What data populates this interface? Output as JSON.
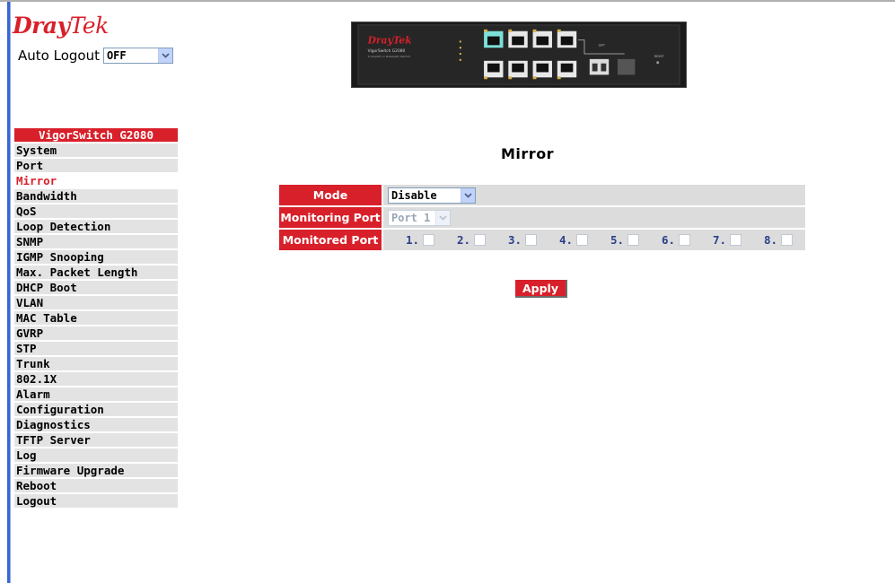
{
  "brand": {
    "logo_part1": "Dray",
    "logo_part2": "Tek"
  },
  "auto_logout": {
    "label": "Auto Logout",
    "value": "OFF"
  },
  "device": {
    "brand": "DrayTek",
    "model": "VigorSwitch G2080",
    "subtitle": "8 GIGABIT L2 MANAGED SWITCH",
    "sfp_label": "SFP",
    "reset_label": "RESET"
  },
  "sidebar": {
    "header": "VigorSwitch G2080",
    "items": [
      {
        "label": "System"
      },
      {
        "label": "Port"
      },
      {
        "label": "Mirror",
        "active": true
      },
      {
        "label": "Bandwidth"
      },
      {
        "label": "QoS"
      },
      {
        "label": "Loop Detection"
      },
      {
        "label": "SNMP"
      },
      {
        "label": "IGMP Snooping"
      },
      {
        "label": "Max. Packet Length"
      },
      {
        "label": "DHCP Boot"
      },
      {
        "label": "VLAN"
      },
      {
        "label": "MAC Table"
      },
      {
        "label": "GVRP"
      },
      {
        "label": "STP"
      },
      {
        "label": "Trunk"
      },
      {
        "label": "802.1X"
      },
      {
        "label": "Alarm"
      },
      {
        "label": "Configuration"
      },
      {
        "label": "Diagnostics"
      },
      {
        "label": "TFTP Server"
      },
      {
        "label": "Log"
      },
      {
        "label": "Firmware Upgrade"
      },
      {
        "label": "Reboot"
      },
      {
        "label": "Logout"
      }
    ]
  },
  "page": {
    "title": "Mirror"
  },
  "form": {
    "mode_label": "Mode",
    "mode_value": "Disable",
    "monitoring_label": "Monitoring Port",
    "monitoring_value": "Port 1",
    "monitored_label": "Monitored Port",
    "ports": [
      "1.",
      "2.",
      "3.",
      "4.",
      "5.",
      "6.",
      "7.",
      "8."
    ]
  },
  "apply_label": "Apply",
  "colors": {
    "accent": "#d8202a",
    "row_bg": "#dcdcdc",
    "menu_bg": "#e3e3e3",
    "port_text": "#2b3f8a"
  }
}
